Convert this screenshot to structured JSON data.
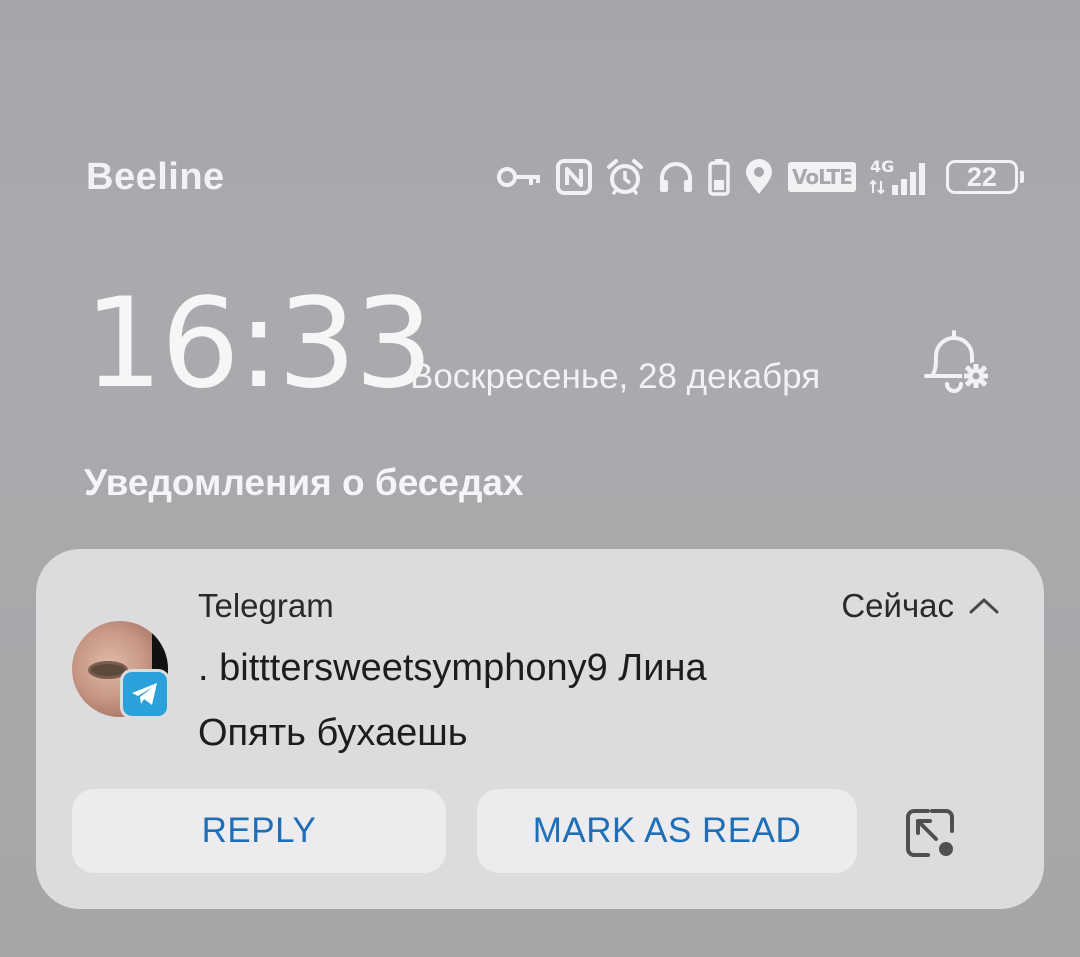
{
  "status_bar": {
    "carrier": "Beeline",
    "volte_label": "VoLTE",
    "network_label": "4G",
    "battery_level": "22",
    "icons": [
      "key-icon",
      "nfc-icon",
      "alarm-icon",
      "headphones-icon",
      "device-battery-icon",
      "location-icon",
      "volte-icon",
      "signal-icon",
      "battery-icon"
    ]
  },
  "lockscreen": {
    "time": "16:33",
    "date": "Воскресенье, 28 декабря",
    "section_title": "Уведомления о беседах"
  },
  "notification": {
    "app_name": "Telegram",
    "time_label": "Сейчас",
    "sender": ". bitttersweetsymphony9 Лина",
    "message": "Опять бухаешь",
    "actions": {
      "reply": "REPLY",
      "mark_as_read": "MARK AS READ"
    },
    "colors": {
      "action_text": "#1e6fb8",
      "telegram_badge": "#2aa1da"
    }
  }
}
